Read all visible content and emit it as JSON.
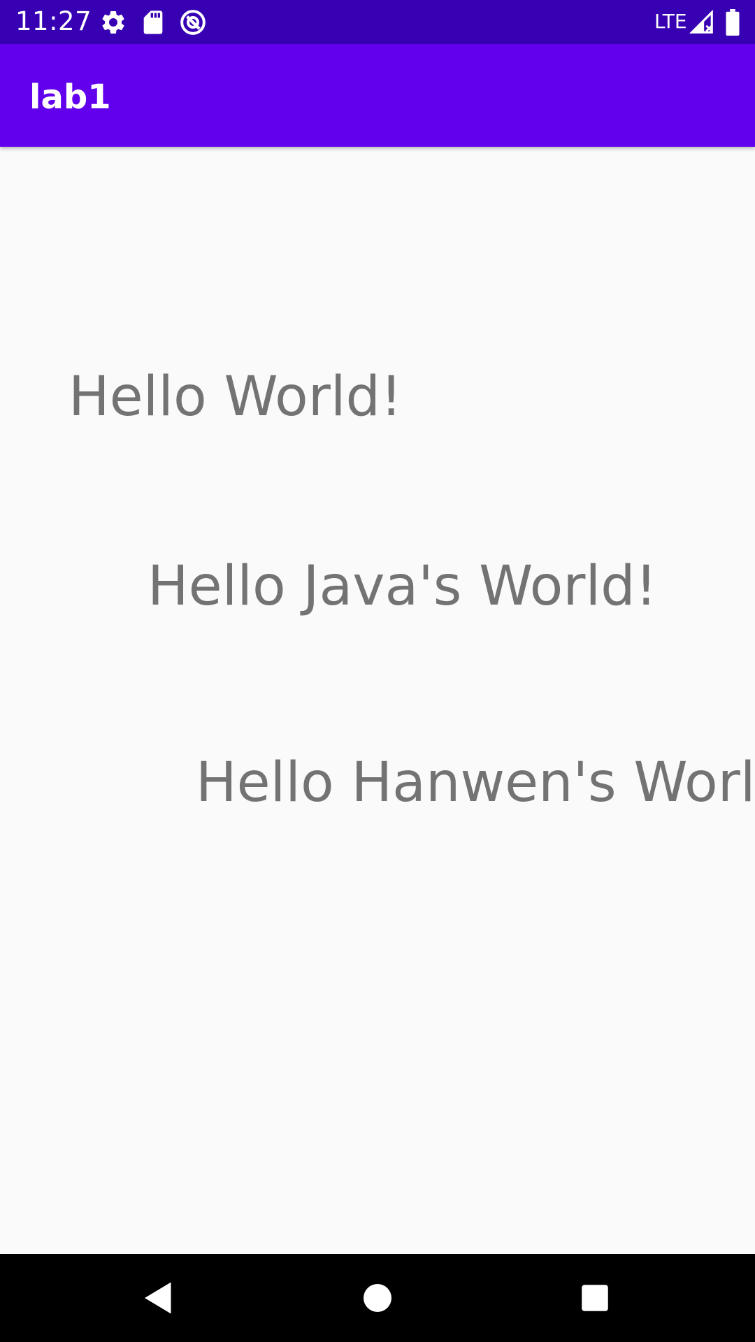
{
  "status_bar": {
    "time": "11:27",
    "network": "LTE",
    "icons": [
      "gear-icon",
      "sd-card-icon",
      "data-saver-icon",
      "signal-icon",
      "battery-icon"
    ]
  },
  "app_bar": {
    "title": "lab1",
    "color": "#6200ee"
  },
  "content": {
    "texts": [
      "Hello World!",
      "Hello Java's World!",
      "Hello Hanwen's World!"
    ],
    "text_color": "#737373",
    "background": "#fafafa"
  },
  "nav_bar": {
    "buttons": [
      "back-icon",
      "home-icon",
      "recents-icon"
    ]
  },
  "colors": {
    "status_bar": "#3700b3",
    "app_bar": "#6200ee"
  }
}
